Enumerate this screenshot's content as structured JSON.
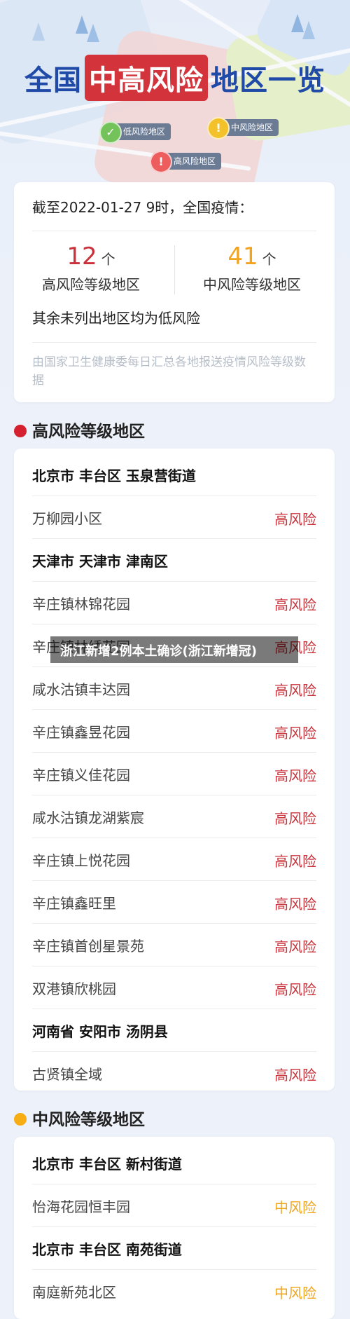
{
  "header": {
    "title_part1": "全国",
    "title_part2": "中高风险",
    "title_part3": "地区一览",
    "legend": {
      "low": {
        "icon": "check",
        "label": "低风险地区"
      },
      "mid": {
        "icon": "!",
        "label": "中风险地区"
      },
      "high": {
        "icon": "!",
        "label": "高风险地区"
      }
    }
  },
  "summary": {
    "as_of": "截至2022-01-27 9时，全国疫情：",
    "high": {
      "count": "12",
      "unit": "个",
      "label": "高风险等级地区"
    },
    "mid": {
      "count": "41",
      "unit": "个",
      "label": "中风险等级地区"
    },
    "rest_note": "其余未列出地区均为低风险",
    "source": "由国家卫生健康委每日汇总各地报送疫情风险等级数据"
  },
  "high_section": {
    "title": "高风险等级地区",
    "rows": [
      {
        "name": "北京市 丰台区 玉泉营街道",
        "level": ""
      },
      {
        "name": "万柳园小区",
        "level": "高风险"
      },
      {
        "name": "天津市 天津市 津南区",
        "level": ""
      },
      {
        "name": "辛庄镇林锦花园",
        "level": "高风险"
      },
      {
        "name": "辛庄镇林绣花园",
        "level": "高风险"
      },
      {
        "name": "咸水沽镇丰达园",
        "level": "高风险"
      },
      {
        "name": "辛庄镇鑫昱花园",
        "level": "高风险"
      },
      {
        "name": "辛庄镇义佳花园",
        "level": "高风险"
      },
      {
        "name": "咸水沽镇龙湖紫宸",
        "level": "高风险"
      },
      {
        "name": "辛庄镇上悦花园",
        "level": "高风险"
      },
      {
        "name": "辛庄镇鑫旺里",
        "level": "高风险"
      },
      {
        "name": "辛庄镇首创星景苑",
        "level": "高风险"
      },
      {
        "name": "双港镇欣桃园",
        "level": "高风险"
      },
      {
        "name": "河南省 安阳市 汤阴县",
        "level": ""
      },
      {
        "name": "古贤镇全域",
        "level": "高风险"
      }
    ]
  },
  "mid_section": {
    "title": "中风险等级地区",
    "rows": [
      {
        "name": "北京市 丰台区 新村街道",
        "level": ""
      },
      {
        "name": "怡海花园恒丰园",
        "level": "中风险"
      },
      {
        "name": "北京市 丰台区 南苑街道",
        "level": ""
      },
      {
        "name": "南庭新苑北区",
        "level": "中风险"
      }
    ]
  },
  "watermark": "浙江新增2例本土确诊(浙江新增冠)",
  "colors": {
    "high": "#c9323a",
    "mid": "#f0a51f",
    "title_blue": "#1f4aa8",
    "title_red": "#d3333b"
  }
}
